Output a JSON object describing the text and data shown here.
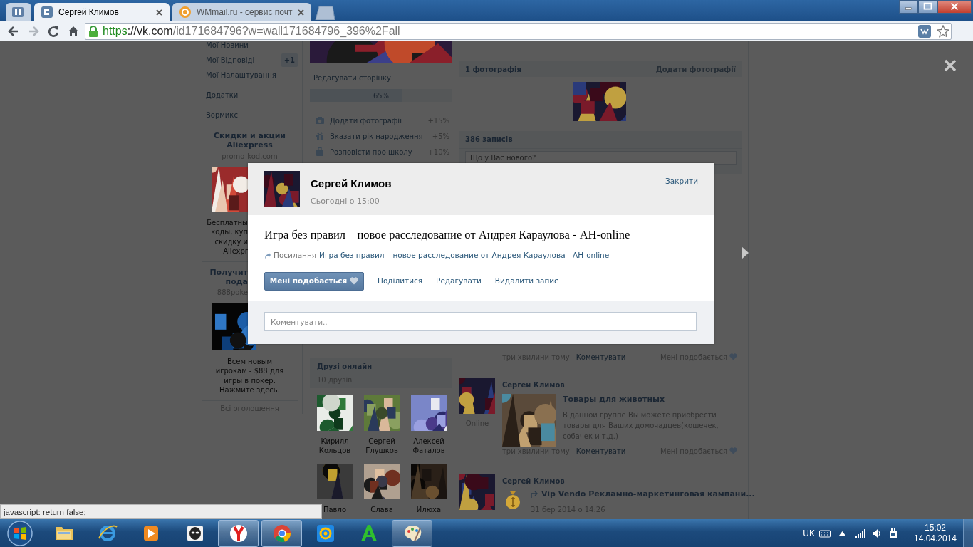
{
  "browser": {
    "tabs": [
      {
        "title": "Сергей Климов",
        "selected": true,
        "kind": "vk"
      },
      {
        "title": "WMmail.ru - сервис почт",
        "selected": false,
        "kind": "mail"
      }
    ],
    "toolbar": [
      {
        "kind": "back",
        "disabled": false
      },
      {
        "kind": "forward",
        "disabled": true
      },
      {
        "kind": "reload",
        "disabled": false
      },
      {
        "kind": "home",
        "disabled": false
      }
    ],
    "address": {
      "secure": true,
      "scheme": "https",
      "host": "://vk.com",
      "path": "/id171684796?w=wall171684796_396%2Fall"
    }
  },
  "left_menu": [
    [
      {
        "label": "Мої Новини"
      },
      {
        "label": "Мої Відповіді",
        "badge": "+1"
      },
      {
        "label": "Мої Налаштування"
      }
    ],
    [
      {
        "label": "Додатки"
      }
    ],
    [
      {
        "label": "Вормикс"
      }
    ]
  ],
  "ads": [
    {
      "title": "Скидки и акции Aliexpress",
      "source": "promo-kod.com",
      "text_lines": [
        "Бесплатны",
        "коды, куп",
        "скидку и",
        "Aliexpr"
      ]
    },
    {
      "title_lines": [
        "Получит",
        "пода"
      ],
      "source": "888poke",
      "text": "Всем новым игрокам - $88 для игры в покер. Нажмите здесь."
    }
  ],
  "all_ads": "Всі оголошення",
  "profile": {
    "edit": "Редагувати сторінку",
    "progress": {
      "label": "65%",
      "level": 0.65
    },
    "tasks": [
      {
        "kind": "camera",
        "label": "Додати фотографії",
        "bonus": "+15%"
      },
      {
        "kind": "gift",
        "label": "Вказати рік народження",
        "bonus": "+5%"
      },
      {
        "kind": "bag",
        "label": "Розповісти про школу",
        "bonus": "+10%"
      }
    ]
  },
  "friends": {
    "title": "Друзі онлайн",
    "count": "10 друзів",
    "people": [
      {
        "name": "Кирилл Кольцов"
      },
      {
        "name": "Сергей Глушков"
      },
      {
        "name": "Алексей Фаталов"
      },
      {
        "name": "Павло"
      },
      {
        "name": "Слава"
      },
      {
        "name": "Илюха"
      }
    ]
  },
  "photos": {
    "title": "1 фотографія",
    "action": "Додати фотографії"
  },
  "wall": {
    "title": "386 записів",
    "placeholder": "Що у Вас нового?",
    "posts": [
      {
        "time": "три хвилини тому",
        "comment": "Коментувати",
        "like": "Мені подобається"
      },
      {
        "author": "Сергей Климов",
        "online": "Online",
        "title": "Товары для животных",
        "text": "В данной группе Вы можете приобрести товары для Ваших домочадцев(кошечек, собачек и т.д.)",
        "time": "три хвилини тому",
        "comment": "Коментувати",
        "like": "Мені подобається"
      },
      {
        "author": "Сергей Климов",
        "repost_title": "Vip Vendo Рекламно-маркетинговая кампани...",
        "date": "31 бер 2014 о 14:26"
      }
    ]
  },
  "dialog": {
    "author": "Сергей Климов",
    "time": "Сьогодні о 15:00",
    "close": "Закрити",
    "title": "Игра без правил – новое расследование от Андрея Караулова - AH-online",
    "link_label": "Посилання",
    "link_text": "Игра без правил – новое расследование от Андрея Караулова - AH-online",
    "like": "Мені подобається",
    "liked": false,
    "actions": [
      "Поділитися",
      "Редагувати",
      "Видалити запис"
    ],
    "comment_placeholder": "Коментувати.."
  },
  "status_bubble": "javascript: return false;",
  "taskbar": {
    "apps": [
      {
        "kind": "folder",
        "selected": false
      },
      {
        "kind": "ie",
        "selected": false
      },
      {
        "kind": "media",
        "selected": false
      },
      {
        "kind": "alien",
        "selected": false
      },
      {
        "kind": "yandex",
        "selected": true
      },
      {
        "kind": "chrome",
        "selected": true
      },
      {
        "kind": "mail",
        "selected": false
      },
      {
        "kind": "letter",
        "selected": false
      },
      {
        "kind": "paint",
        "selected": true
      }
    ],
    "language": "UK",
    "time": "15:02",
    "date": "14.04.2014"
  }
}
